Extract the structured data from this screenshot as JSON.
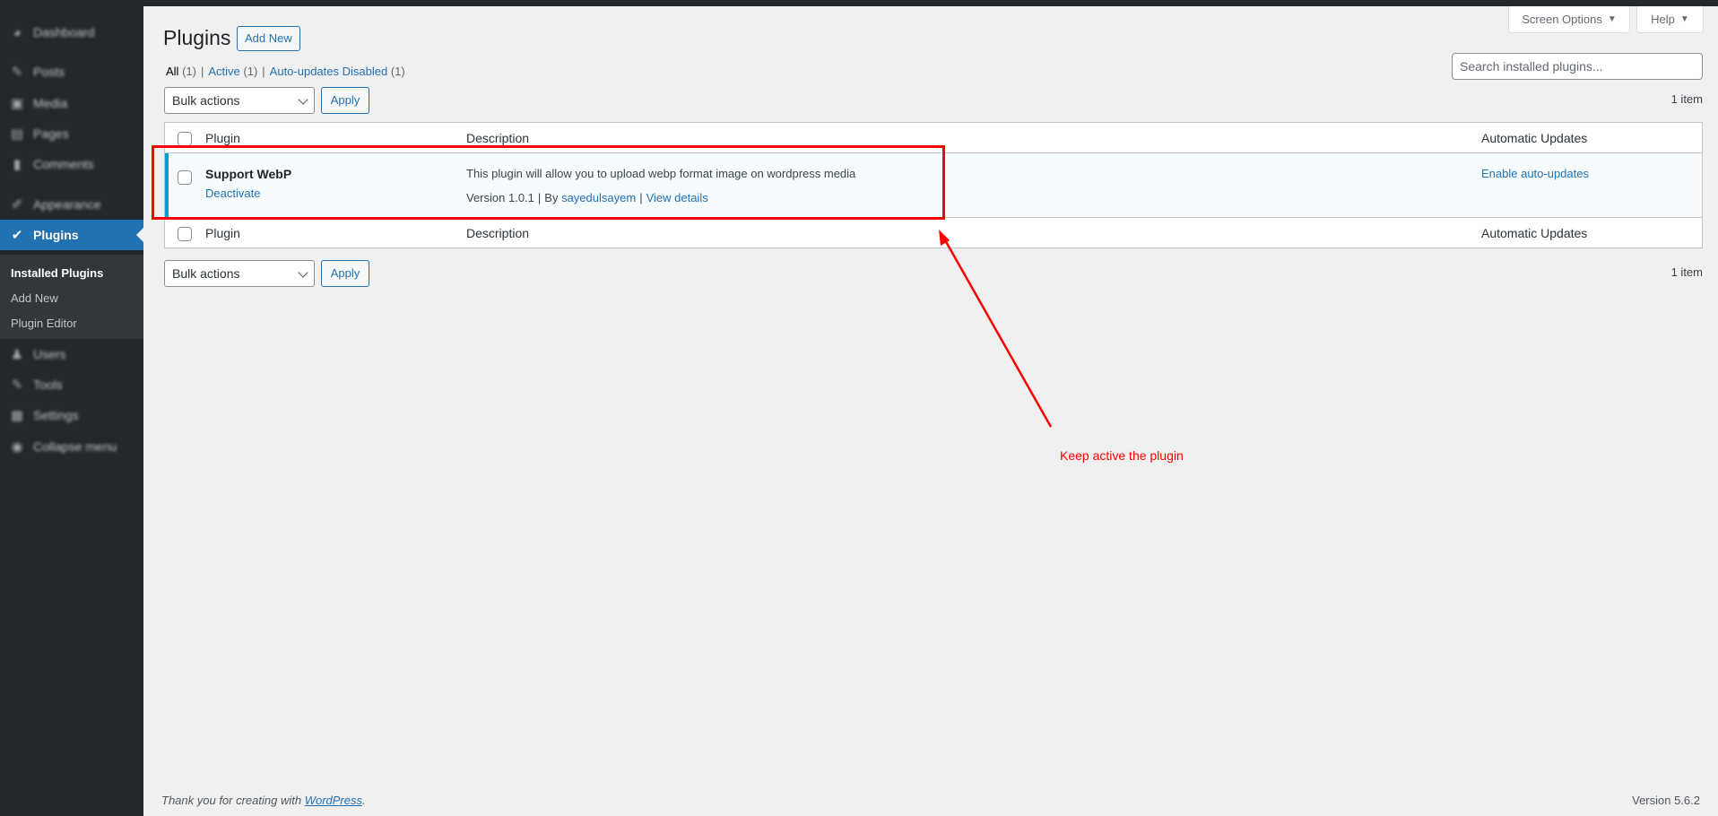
{
  "sidebar": {
    "items": [
      {
        "label": "Dashboard",
        "icon": "dashboard-icon",
        "glyph": "◕"
      },
      {
        "label": "Posts",
        "icon": "pin-icon",
        "glyph": "✎"
      },
      {
        "label": "Media",
        "icon": "media-icon",
        "glyph": "▣"
      },
      {
        "label": "Pages",
        "icon": "pages-icon",
        "glyph": "▤"
      },
      {
        "label": "Comments",
        "icon": "comment-icon",
        "glyph": "▮"
      },
      {
        "label": "Appearance",
        "icon": "brush-icon",
        "glyph": "✐"
      },
      {
        "label": "Plugins",
        "icon": "plugin-icon",
        "glyph": "✔"
      },
      {
        "label": "Users",
        "icon": "user-icon",
        "glyph": "♟"
      },
      {
        "label": "Tools",
        "icon": "wrench-icon",
        "glyph": "✎"
      },
      {
        "label": "Settings",
        "icon": "settings-icon",
        "glyph": "▦"
      },
      {
        "label": "Collapse menu",
        "icon": "collapse-icon",
        "glyph": "◉"
      }
    ],
    "submenu": [
      {
        "label": "Installed Plugins",
        "current": true
      },
      {
        "label": "Add New",
        "current": false
      },
      {
        "label": "Plugin Editor",
        "current": false
      }
    ]
  },
  "header": {
    "screen_options": "Screen Options",
    "help": "Help",
    "caret": "▼",
    "title": "Plugins",
    "add_new": "Add New"
  },
  "filters": {
    "all": "All",
    "all_count": "(1)",
    "active": "Active",
    "active_count": "(1)",
    "auto_disabled": "Auto-updates Disabled",
    "auto_disabled_count": "(1)",
    "separator": "|"
  },
  "search": {
    "placeholder": "Search installed plugins...",
    "value": ""
  },
  "tablenav": {
    "bulk_actions": "Bulk actions",
    "apply": "Apply",
    "count": "1 item"
  },
  "table": {
    "columns": {
      "plugin": "Plugin",
      "description": "Description",
      "auto_updates": "Automatic Updates"
    },
    "rows": [
      {
        "name": "Support WebP",
        "action": "Deactivate",
        "description": "This plugin will allow you to upload webp format image on wordpress media",
        "version": "Version 1.0.1",
        "by": "By",
        "author": "sayedulsayem",
        "view_details": "View details",
        "auto_update_action": "Enable auto-updates",
        "status": "active"
      }
    ]
  },
  "annotation": {
    "text": "Keep active the plugin",
    "color": "#ff0000"
  },
  "footer": {
    "thanks_prefix": "Thank you for creating with",
    "wordpress_link": "WordPress",
    "thanks_suffix": ".",
    "version": "Version 5.6.2"
  },
  "colors": {
    "accent": "#2271b1",
    "sidebar_bg": "#23282d",
    "active_row_border": "#00a0d2",
    "annotation": "#ff0000"
  }
}
